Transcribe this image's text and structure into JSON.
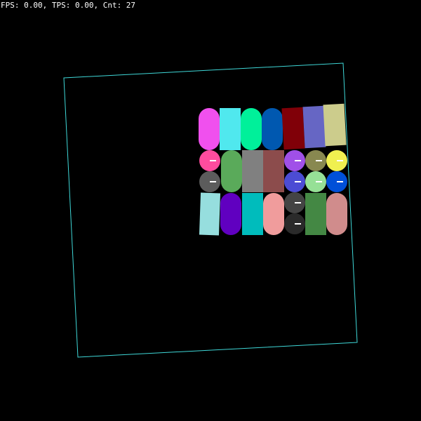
{
  "hud": {
    "stats_text": "FPS: 0.00, TPS: 0.00, Cnt: 27"
  },
  "colors": {
    "background": "#000000",
    "boundary": "#3fd8d8",
    "text": "#ffffff",
    "marker": "#ffffff"
  },
  "bodies": [
    {
      "shape": "capsule",
      "color": "#f050ee"
    },
    {
      "shape": "box",
      "color": "#50e8ee"
    },
    {
      "shape": "capsule",
      "color": "#00f09a"
    },
    {
      "shape": "capsule",
      "color": "#0058b0"
    },
    {
      "shape": "box",
      "color": "#800008"
    },
    {
      "shape": "box",
      "color": "#6666c4"
    },
    {
      "shape": "box",
      "color": "#cccc8c"
    },
    {
      "shape": "circle",
      "color": "#ff4c9e"
    },
    {
      "shape": "capsule",
      "color": "#5aaa5a"
    },
    {
      "shape": "box",
      "color": "#808080"
    },
    {
      "shape": "box",
      "color": "#8c4c4c"
    },
    {
      "shape": "circle",
      "color": "#a050e8"
    },
    {
      "shape": "circle",
      "color": "#888850"
    },
    {
      "shape": "circle",
      "color": "#f0f050"
    },
    {
      "shape": "circle",
      "color": "#5c5c5c"
    },
    {
      "shape": "circle",
      "color": "#4c4cd4"
    },
    {
      "shape": "circle",
      "color": "#96e096"
    },
    {
      "shape": "circle",
      "color": "#0050d8"
    },
    {
      "shape": "box",
      "color": "#96dede"
    },
    {
      "shape": "capsule",
      "color": "#6000c0"
    },
    {
      "shape": "box",
      "color": "#00bcbc"
    },
    {
      "shape": "capsule",
      "color": "#f09c9c"
    },
    {
      "shape": "circle",
      "color": "#444444"
    },
    {
      "shape": "box",
      "color": "#448844"
    },
    {
      "shape": "capsule",
      "color": "#d08c8c"
    },
    {
      "shape": "circle",
      "color": "#2a2a2a"
    }
  ]
}
